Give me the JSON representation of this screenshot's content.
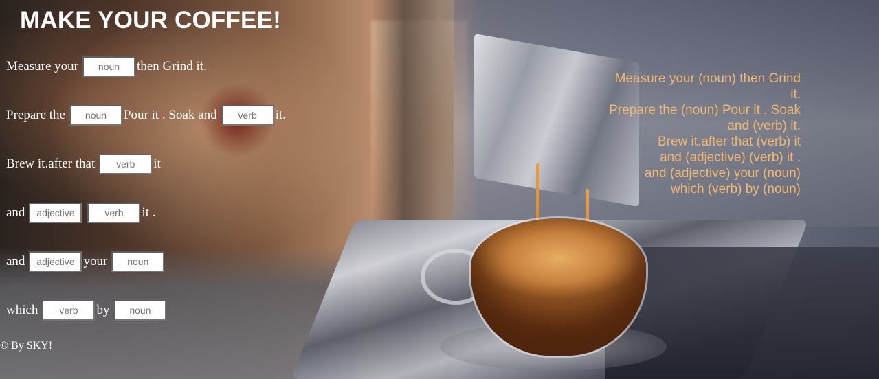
{
  "title": "MAKE YOUR COFFEE!",
  "form": {
    "rows": [
      {
        "parts": [
          "Measure your",
          "then Grind it."
        ],
        "placeholders": [
          "noun"
        ]
      },
      {
        "parts": [
          "Prepare the",
          "Pour it . Soak and",
          "it."
        ],
        "placeholders": [
          "noun",
          "verb"
        ]
      },
      {
        "parts": [
          "Brew it.after that",
          "it"
        ],
        "placeholders": [
          "verb"
        ]
      },
      {
        "parts": [
          "and",
          "",
          "it ."
        ],
        "placeholders": [
          "adjective",
          "verb"
        ]
      },
      {
        "parts": [
          "and",
          "your",
          ""
        ],
        "placeholders": [
          "adjective",
          "noun"
        ]
      },
      {
        "parts": [
          "which",
          "by",
          ""
        ],
        "placeholders": [
          "verb",
          "noun"
        ]
      }
    ]
  },
  "story": {
    "lines": [
      "Measure your (noun) then Grind",
      "it.",
      "Prepare the (noun) Pour it . Soak",
      "and (verb) it.",
      "Brew it.after that (verb) it",
      "and (adjective) (verb) it .",
      "and (adjective) your (noun)",
      "which (verb) by (noun)"
    ],
    "color": "#f2b871"
  },
  "footer": {
    "copyright": "© By SKY!"
  }
}
